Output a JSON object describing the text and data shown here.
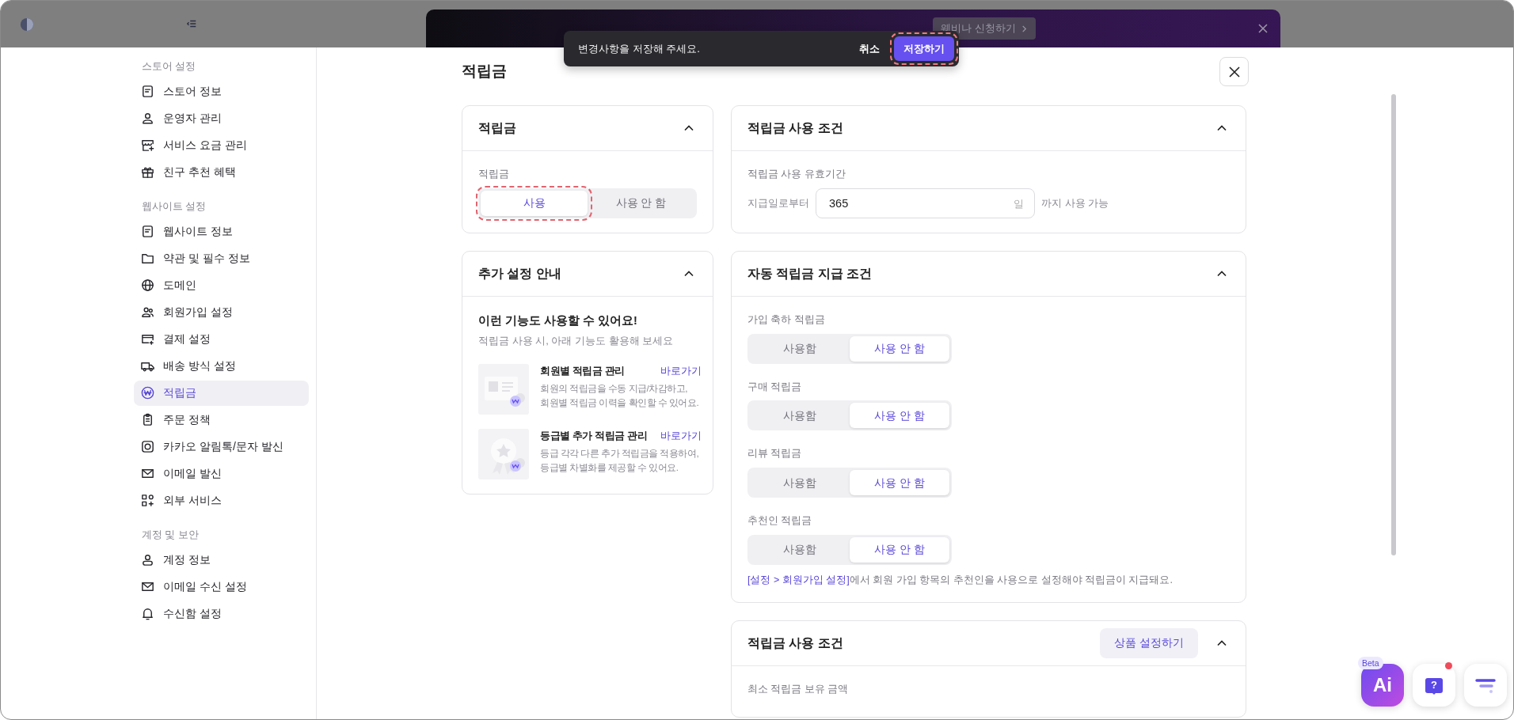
{
  "top_bar": {
    "banner": {
      "button": "웨비나 신청하기"
    }
  },
  "toast": {
    "message": "변경사항을 저장해 주세요.",
    "cancel": "취소",
    "save": {
      "label": "저장하기",
      "highlighted": true
    }
  },
  "sidebar": {
    "sections": [
      {
        "title": "스토어 설정",
        "items": [
          {
            "label": "스토어 정보",
            "selected": false
          },
          {
            "label": "운영자 관리",
            "selected": false
          },
          {
            "label": "서비스 요금 관리",
            "selected": false
          },
          {
            "label": "친구 추천 혜택",
            "selected": false
          }
        ]
      },
      {
        "title": "웹사이트 설정",
        "items": [
          {
            "label": "웹사이트 정보",
            "selected": false
          },
          {
            "label": "약관 및 필수 정보",
            "selected": false
          },
          {
            "label": "도메인",
            "selected": false
          },
          {
            "label": "회원가입 설정",
            "selected": false
          },
          {
            "label": "결제 설정",
            "selected": false
          },
          {
            "label": "배송 방식 설정",
            "selected": false
          },
          {
            "label": "적립금",
            "selected": true
          },
          {
            "label": "주문 정책",
            "selected": false
          },
          {
            "label": "카카오 알림톡/문자 발신",
            "selected": false
          },
          {
            "label": "이메일 발신",
            "selected": false
          },
          {
            "label": "외부 서비스",
            "selected": false
          }
        ]
      },
      {
        "title": "계정 및 보안",
        "items": [
          {
            "label": "계정 정보",
            "selected": false
          },
          {
            "label": "이메일 수신 설정",
            "selected": false
          },
          {
            "label": "수신함 설정",
            "selected": false
          }
        ]
      }
    ]
  },
  "page": {
    "title": "적립금"
  },
  "left_cards": [
    {
      "kind": "toggle",
      "title": "적립금",
      "expanded": true,
      "field_label": "적립금",
      "options": [
        {
          "label": "사용",
          "selected": true,
          "highlighted": true
        },
        {
          "label": "사용 안 함",
          "selected": false,
          "highlighted": false
        }
      ]
    },
    {
      "kind": "guide",
      "title": "추가 설정 안내",
      "expanded": true,
      "heading": "이런 기능도 사용할 수 있어요!",
      "subheading": "적립금 사용 시, 아래 기능도 활용해 보세요",
      "features": [
        {
          "title": "회원별 적립금 관리",
          "link": "바로가기",
          "description": "회원의 적립금을 수동 지급/차감하고,\n회원별 적립금 이력을 확인할 수 있어요."
        },
        {
          "title": "등급별 추가 적립금 관리",
          "link": "바로가기",
          "description": "등급 각각 다른 추가 적립금을 적용하여,\n등급별 차별화를 제공할 수 있어요."
        }
      ]
    }
  ],
  "right_cards": [
    {
      "kind": "period",
      "title": "적립금 사용 조건",
      "expanded": true,
      "field_label": "적립금 사용 유효기간",
      "prefix": "지급일로부터",
      "value": "365",
      "unit": "일",
      "suffix": "까지 사용 가능"
    },
    {
      "kind": "auto",
      "title": "자동 적립금 지급 조건",
      "expanded": true,
      "groups": [
        {
          "label": "가입 축하 적립금",
          "options": [
            {
              "label": "사용함",
              "selected": false
            },
            {
              "label": "사용 안 함",
              "selected": true
            }
          ]
        },
        {
          "label": "구매 적립금",
          "options": [
            {
              "label": "사용함",
              "selected": false
            },
            {
              "label": "사용 안 함",
              "selected": true
            }
          ]
        },
        {
          "label": "리뷰 적립금",
          "options": [
            {
              "label": "사용함",
              "selected": false
            },
            {
              "label": "사용 안 함",
              "selected": true
            }
          ]
        },
        {
          "label": "추천인 적립금",
          "options": [
            {
              "label": "사용함",
              "selected": false
            },
            {
              "label": "사용 안 함",
              "selected": true
            }
          ]
        }
      ],
      "note": {
        "link": "[설정 > 회원가입 설정]",
        "text": "에서 회원 가입 항목의 추천인을 사용으로 설정해야 적립금이 지급돼요."
      }
    },
    {
      "kind": "minimum",
      "title": "적립금 사용 조건",
      "expanded": true,
      "action": "상품 설정하기",
      "field_label": "최소 적립금 보유 금액"
    }
  ],
  "floating": {
    "ai": {
      "badge": "Beta",
      "label": "Ai"
    },
    "help": {
      "label": "?",
      "notification": true
    }
  }
}
